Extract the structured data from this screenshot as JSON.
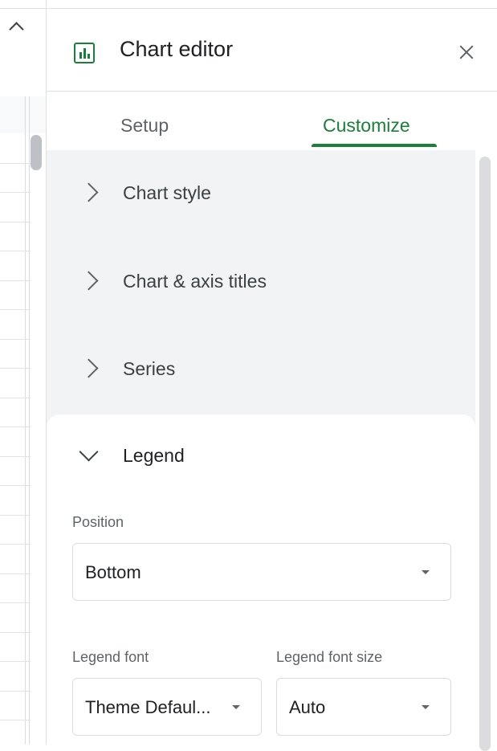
{
  "panel": {
    "title": "Chart editor",
    "tabs": [
      {
        "label": "Setup",
        "active": false
      },
      {
        "label": "Customize",
        "active": true
      }
    ],
    "sections": [
      {
        "label": "Chart style",
        "expanded": false
      },
      {
        "label": "Chart & axis titles",
        "expanded": false
      },
      {
        "label": "Series",
        "expanded": false
      },
      {
        "label": "Legend",
        "expanded": true
      }
    ],
    "legend": {
      "position_label": "Position",
      "position_value": "Bottom",
      "font_label": "Legend font",
      "font_value": "Theme Defaul...",
      "font_size_label": "Legend font size",
      "font_size_value": "Auto"
    }
  },
  "colors": {
    "accent": "#188038",
    "section_bg": "#f1f3f4",
    "text": "#202124",
    "muted": "#5f6368"
  },
  "icons": [
    "chart-icon",
    "close-icon",
    "chevron-right-icon",
    "chevron-down-icon",
    "dropdown-arrow-icon",
    "collapse-caret-icon"
  ]
}
